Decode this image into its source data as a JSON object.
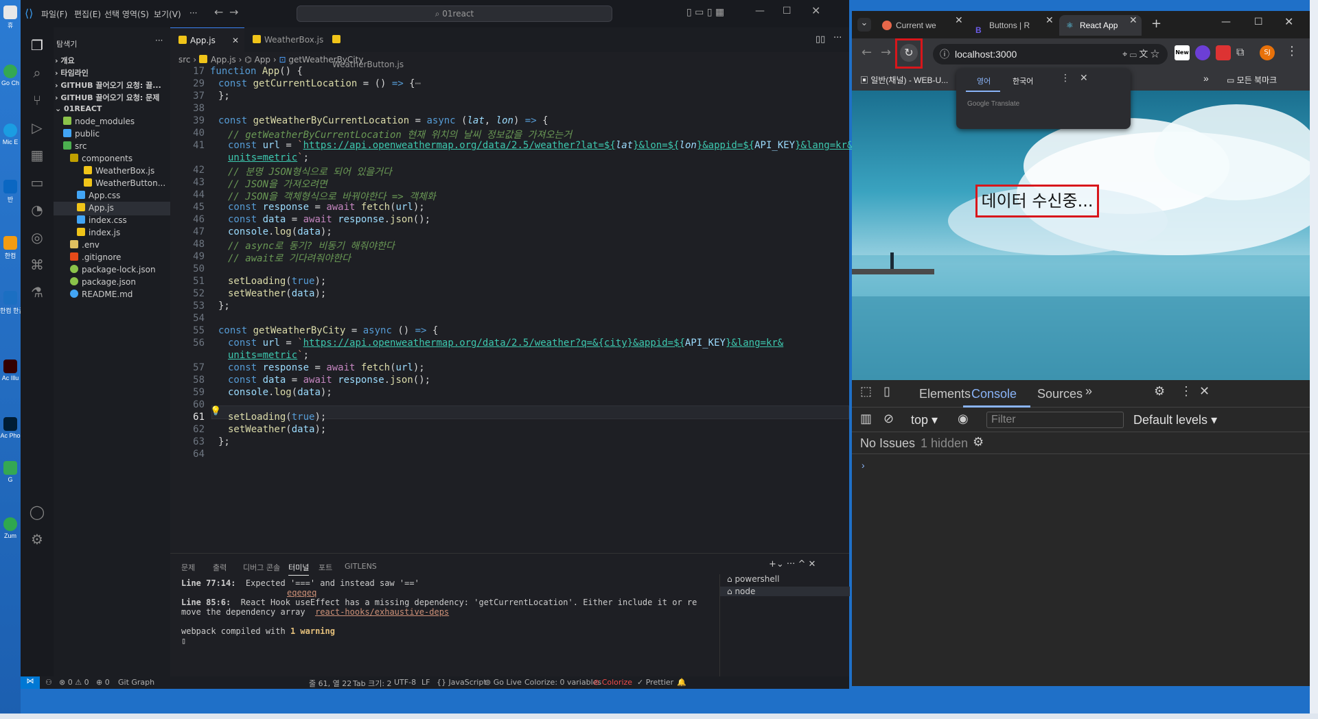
{
  "desktop": {
    "icons": [
      "휴",
      "Go Ch",
      "Mic E",
      "반",
      "한컴",
      "한컴 한글",
      "Ac Illu",
      "Ac Pho",
      "G",
      "Zum"
    ]
  },
  "vscode": {
    "menu": [
      "파일(F)",
      "편집(E)",
      "선택 영역(S)",
      "보기(V)",
      "···"
    ],
    "search_placeholder": "01react",
    "explorer_title": "탐색기",
    "tree": [
      {
        "label": "개요",
        "icon": "chevron-right"
      },
      {
        "label": "타임라인",
        "icon": "chevron-right"
      },
      {
        "label": "GITHUB 끌어오기 요청: 끌...",
        "icon": "chevron-right"
      },
      {
        "label": "GITHUB 끌어오기 요청: 문제",
        "icon": "chevron-right"
      },
      {
        "label": "01REACT",
        "icon": "chevron-down"
      },
      {
        "label": "node_modules",
        "icon": "folder"
      },
      {
        "label": "public",
        "icon": "folder"
      },
      {
        "label": "src",
        "icon": "folder-open"
      },
      {
        "label": "components",
        "icon": "folder-open"
      },
      {
        "label": "WeatherBox.js",
        "icon": "js"
      },
      {
        "label": "WeatherButton...",
        "icon": "js"
      },
      {
        "label": "App.css",
        "icon": "css"
      },
      {
        "label": "App.js",
        "icon": "js"
      },
      {
        "label": "index.css",
        "icon": "css"
      },
      {
        "label": "index.js",
        "icon": "js"
      },
      {
        "label": ".env",
        "icon": "env"
      },
      {
        "label": ".gitignore",
        "icon": "git"
      },
      {
        "label": "package-lock.json",
        "icon": "json"
      },
      {
        "label": "package.json",
        "icon": "json"
      },
      {
        "label": "README.md",
        "icon": "info"
      }
    ],
    "tabs": [
      "App.js",
      "WeatherBox.js",
      "WeatherButton.js"
    ],
    "breadcrumb": [
      "src",
      "App.js",
      "App",
      "getWeatherByCity"
    ],
    "code_line_numbers": [
      "17",
      "29",
      "37",
      "38",
      "39",
      "40",
      "41",
      "",
      "42",
      "43",
      "44",
      "45",
      "46",
      "47",
      "48",
      "49",
      "50",
      "51",
      "52",
      "53",
      "54",
      "55",
      "56",
      "",
      "57",
      "58",
      "59",
      "60",
      "61",
      "62",
      "63",
      "64"
    ],
    "panel_tabs": [
      "문제",
      "출력",
      "디버그 콘솔",
      "터미널",
      "포트",
      "GITLENS"
    ],
    "terminal": {
      "line1_label": "Line 77:14:",
      "line1_text": "  Expected '===' and instead saw '=='",
      "line1_rule": "eqeqeq",
      "line2_label": "Line 85:6:",
      "line2_text": "  React Hook useEffect has a missing dependency: 'getCurrentLocation'. Either include it or re",
      "line3_text": "move the dependency array  ",
      "line3_rule": "react-hooks/exhaustive-deps",
      "compiled_prefix": "webpack compiled with ",
      "compiled_warn": "1 warning"
    },
    "terminal_list": [
      "powershell",
      "node"
    ],
    "status": {
      "errors": "⊗ 0 ⚠ 0",
      "ports": "⊕ 0",
      "git_graph": "Git Graph",
      "position": "줄 61, 열 22",
      "tab_size": "Tab 크기: 2",
      "encoding": "UTF-8",
      "eol": "LF",
      "language": "JavaScript",
      "golive": "Go Live",
      "colorize_vars": "Colorize: 0 variables",
      "colorize": "Colorize",
      "prettier": "Prettier"
    }
  },
  "chrome": {
    "tabs": [
      {
        "title": "Current we",
        "active": false
      },
      {
        "title": "Buttons | R",
        "active": false
      },
      {
        "title": "React App",
        "active": true
      }
    ],
    "url": "localhost:3000",
    "bookmark1": "일반(채널) - WEB-U...",
    "bookmark_all": "모든 북마크",
    "translate": {
      "lang1": "영어",
      "lang2": "한국어",
      "footer": "Google Translate"
    },
    "page_message": "데이터 수신중...",
    "devtools": {
      "tabs": [
        "Elements",
        "Console",
        "Sources"
      ],
      "context": "top",
      "filter_placeholder": "Filter",
      "levels": "Default levels",
      "no_issues": "No Issues",
      "hidden": "1 hidden"
    }
  },
  "colors": {
    "accent": "#3b82f6",
    "highlight_box": "#d8161b"
  }
}
